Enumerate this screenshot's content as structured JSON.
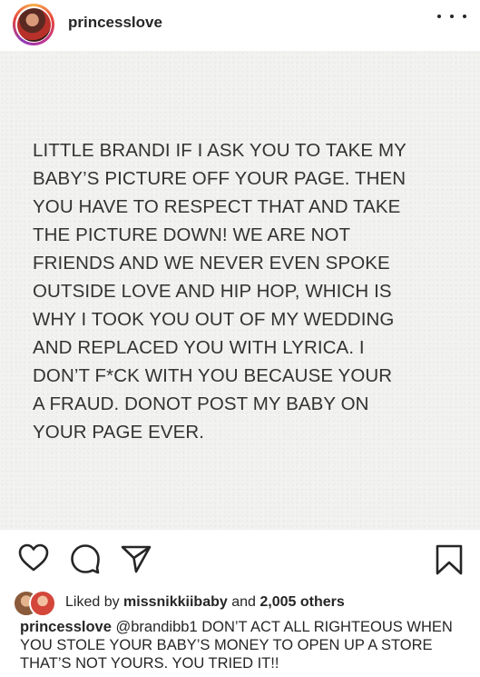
{
  "header": {
    "username": "princesslove",
    "avatar_icon": "profile-avatar",
    "more_icon": "more-options-icon"
  },
  "post": {
    "text": "LITTLE BRANDI IF I ASK YOU TO TAKE MY\nBABY’S PICTURE OFF YOUR PAGE. THEN\nYOU HAVE TO RESPECT THAT AND TAKE\nTHE PICTURE DOWN! WE ARE NOT\nFRIENDS AND WE NEVER EVEN SPOKE\nOUTSIDE LOVE AND HIP HOP, WHICH IS\nWHY I TOOK YOU OUT OF MY WEDDING\nAND REPLACED YOU WITH LYRICA. I\nDON’T F*CK WITH YOU BECAUSE YOUR\nA FRAUD. DONOT POST MY BABY ON\nYOUR PAGE EVER.",
    "background_color": "#f2f2f0"
  },
  "actions": {
    "like_icon": "heart-icon",
    "comment_icon": "comment-icon",
    "share_icon": "send-icon",
    "save_icon": "bookmark-icon"
  },
  "likes": {
    "prefix": "Liked by",
    "user": "missnikkiibaby",
    "and": "and",
    "count": "2,005 others"
  },
  "caption": {
    "username": "princesslove",
    "text": " @brandibb1 DON’T ACT ALL RIGHTEOUS WHEN YOU STOLE YOUR BABY’S MONEY TO OPEN UP A STORE THAT’S NOT YOURS. YOU TRIED IT!!"
  }
}
